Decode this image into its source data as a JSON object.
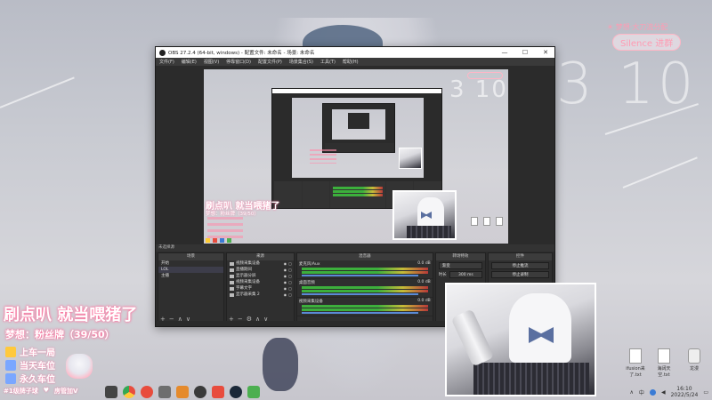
{
  "wallpaper": {
    "clock_digits": "3 10",
    "nested_clock": "3 10",
    "accent_pink": "#ff9bb3"
  },
  "top_right": {
    "title": "梦想·大刀流分配",
    "pill": "Silence 进群"
  },
  "obs": {
    "title": "OBS 27.2.4 (64-bit, windows) - 配置文件: 未命名 - 场景: 未命名",
    "menu": [
      "文件(F)",
      "编辑(E)",
      "视图(V)",
      "停靠窗口(D)",
      "配置文件(P)",
      "场景集合(S)",
      "工具(T)",
      "帮助(H)"
    ],
    "status_bar": "未选择源",
    "docks": {
      "scenes": {
        "header": "场景",
        "items": [
          "开始",
          "LOL",
          "主播"
        ]
      },
      "sources": {
        "header": "来源",
        "items": [
          "视频采集设备",
          "直播期间",
          "显示器分屏",
          "视频采集设备",
          "字幕文字",
          "显示器采集 2"
        ]
      },
      "mixer": {
        "header": "混音器",
        "rows": [
          {
            "name": "麦克风/Aux",
            "db": "0.0 dB"
          },
          {
            "name": "桌面音频",
            "db": "0.0 dB"
          },
          {
            "name": "视频采集设备",
            "db": "0.0 dB"
          }
        ]
      },
      "transitions": {
        "header": "转场特效",
        "type": "渐变",
        "duration_label": "时长",
        "duration": "300 ms"
      },
      "controls": {
        "header": "控件",
        "buttons": [
          "停止推流",
          "停止录制"
        ]
      }
    },
    "footer": "LIVE: 12:08  REC: 00:00:00  CPU: 2.9%, 30.00 fps"
  },
  "overlay": {
    "headline": "刷点叭 就当喂猪了",
    "subtitle": "梦想：粉丝牌（39/50）",
    "lines": [
      "上车一局",
      "当天车位",
      "永久车位"
    ],
    "footer_left": "#1级牌子球",
    "footer_right": "房管加V"
  },
  "desktop_icons": [
    "ifusion来了.txt",
    "海阔天空.txt",
    "龙漫"
  ],
  "tray": {
    "time": "16:10",
    "date": "2022/5/24",
    "lang": "中"
  }
}
